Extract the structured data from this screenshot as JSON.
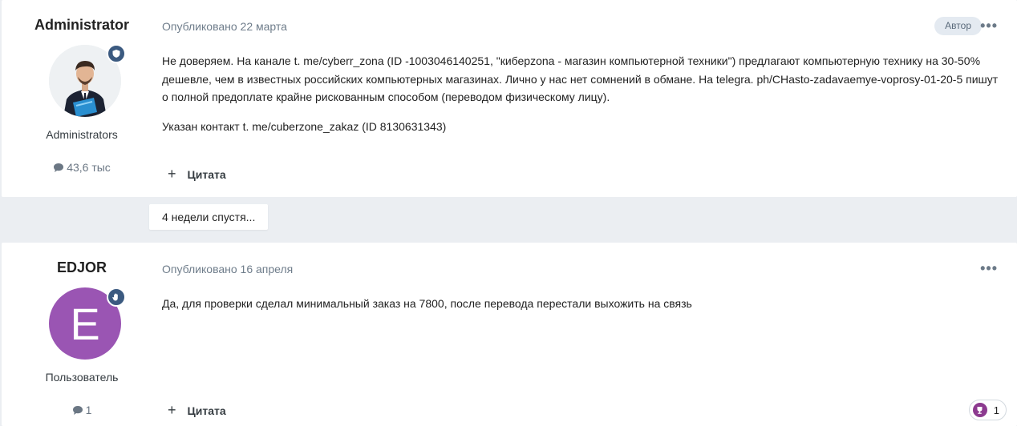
{
  "posts": [
    {
      "author": "Administrator",
      "group": "Administrators",
      "post_count": "43,6 тыс",
      "published": "Опубликовано 22 марта",
      "author_badge": "Автор",
      "paragraphs": [
        "Не доверяем. На канале t. me/cyberr_zona (ID -1003046140251, \"киберzona - магазин компьютерной техники\") предлагают компьютерную технику на 30-50% дешевле, чем в известных российских компьютерных магазинах. Лично у нас нет сомнений в обмане. На telegra. ph/CHasto-zadavaemye-voprosy-01-20-5 пишут о полной предоплате крайне рискованным способом (переводом физическому лицу).",
        "Указан контакт t. me/cuberzone_zakaz (ID 8130631343)"
      ],
      "quote_label": "Цитата",
      "more_label": "•••"
    },
    {
      "author": "EDJOR",
      "avatar_letter": "E",
      "group": "Пользователь",
      "post_count": "1",
      "published": "Опубликовано 16 апреля",
      "paragraphs": [
        "Да, для проверки сделал минимальный заказ на 7800, после перевода перестали выхожить на связь"
      ],
      "quote_label": "Цитата",
      "more_label": "•••",
      "reaction_count": "1"
    }
  ],
  "time_gap_label": "4 недели спустя...",
  "colors": {
    "badge_blue": "#3b5a80",
    "avatar_purple": "#9a55b3",
    "trophy_purple": "#8c3a8f",
    "page_bg": "#ebeef2"
  },
  "icons": {
    "admin_badge": "shield-icon",
    "user_badge": "hand-icon",
    "post_count": "speech-bubble-icon",
    "quote": "plus-icon",
    "reaction": "trophy-icon",
    "more": "ellipsis-icon"
  }
}
